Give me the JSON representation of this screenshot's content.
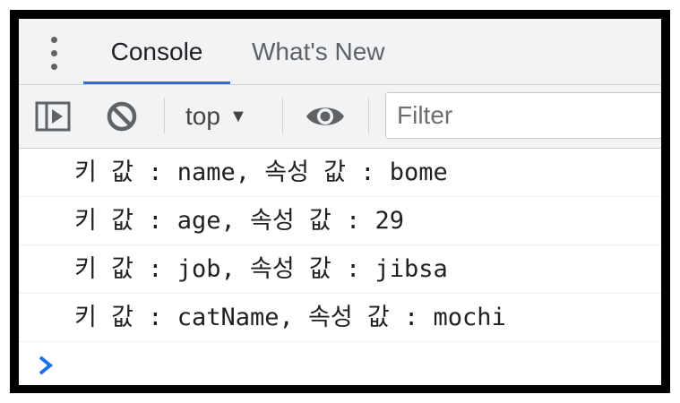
{
  "tabs": [
    {
      "label": "Console",
      "active": true
    },
    {
      "label": "What's New",
      "active": false
    }
  ],
  "toolbar": {
    "context_label": "top",
    "context_arrow": "▼",
    "filter_placeholder": "Filter"
  },
  "log": [
    "키 값 : name, 속성 값 : bome",
    "키 값 : age, 속성 값 : 29",
    "키 값 : job, 속성 값 : jibsa",
    "키 값 : catName, 속성 값 : mochi"
  ],
  "colors": {
    "accent": "#1a73e8",
    "toolbar_bg": "#f1f3f4",
    "icon": "#5f6368",
    "prompt": "#1a73e8"
  },
  "icons": {
    "menu": "kebab-menu-icon",
    "sidebar": "show-sidebar-icon",
    "clear": "clear-console-icon",
    "eye": "live-expression-icon",
    "prompt": "chevron-right-icon"
  }
}
